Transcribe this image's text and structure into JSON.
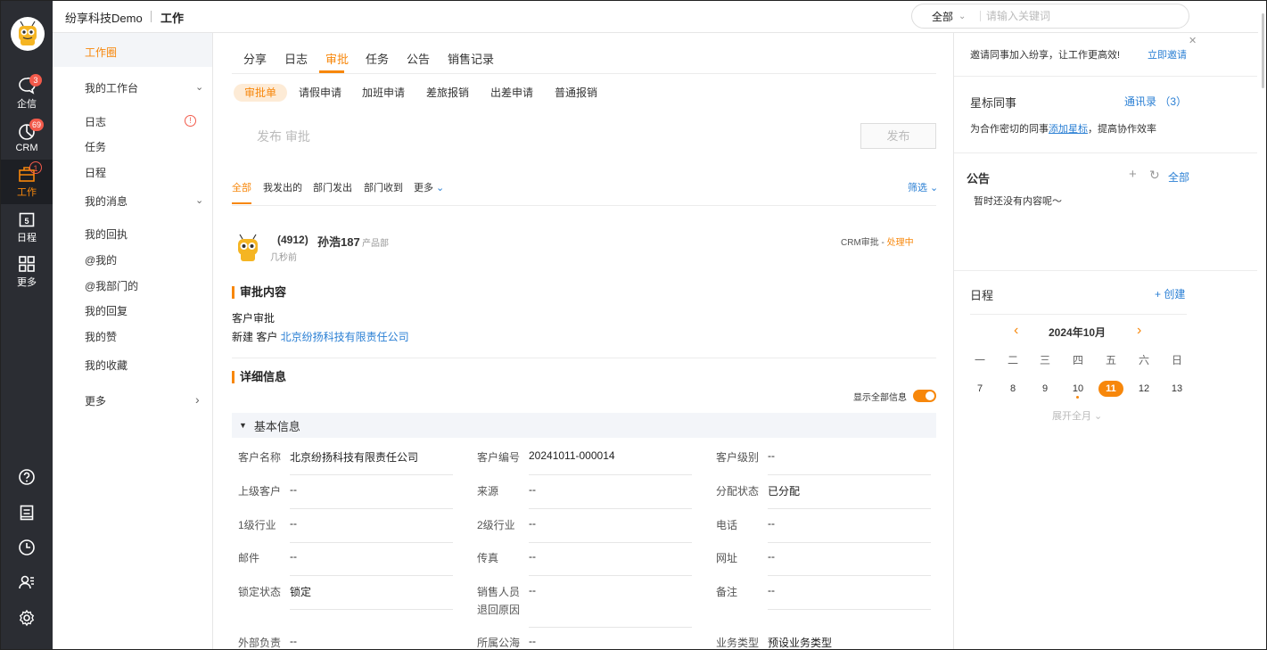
{
  "header": {
    "company": "纷享科技Demo",
    "section": "工作",
    "search_scope": "全部",
    "search_placeholder": "请输入关键词"
  },
  "rail": [
    {
      "label": "企信",
      "icon": "chat-icon",
      "badge": "3"
    },
    {
      "label": "CRM",
      "icon": "crm-icon",
      "badge": "69"
    },
    {
      "label": "工作",
      "icon": "briefcase-icon",
      "badge": "1",
      "active": true
    },
    {
      "label": "日程",
      "icon": "calendar-icon"
    },
    {
      "label": "更多",
      "icon": "grid-icon"
    }
  ],
  "rail_bottom_icons": [
    "help-icon",
    "notebook-icon",
    "clock-icon",
    "contacts-icon",
    "settings-icon"
  ],
  "sidebar": {
    "work_circle": "工作圈",
    "my_workbench": "我的工作台",
    "log": "日志",
    "log_badge": "!",
    "task": "任务",
    "schedule": "日程",
    "my_messages": "我的消息",
    "receipt": "我的回执",
    "at_me": "@我的",
    "at_dept": "@我部门的",
    "my_reply": "我的回复",
    "my_likes": "我的赞",
    "my_favorites": "我的收藏",
    "more": "更多"
  },
  "tabs": [
    "分享",
    "日志",
    "审批",
    "任务",
    "公告",
    "销售记录"
  ],
  "subtabs": [
    "审批单",
    "请假申请",
    "加班申请",
    "差旅报销",
    "出差申请",
    "普通报销"
  ],
  "publish": {
    "placeholder": "发布 审批",
    "button": "发布"
  },
  "filters": [
    "全部",
    "我发出的",
    "部门发出",
    "部门收到",
    "更多"
  ],
  "screen_label": "筛选",
  "post": {
    "id": "(4912)",
    "name": "孙浩187",
    "dept": "产品部",
    "time": "几秒前",
    "status_prefix": "CRM审批 - ",
    "status": "处理中",
    "approval_section": "审批内容",
    "approval_name": "客户审批",
    "approval_action": "新建 客户 ",
    "approval_link": "北京纷扬科技有限责任公司",
    "detail_section": "详细信息",
    "show_all": "显示全部信息",
    "group": "基本信息"
  },
  "fields": [
    [
      {
        "label": "客户名称",
        "value": "北京纷扬科技有限责任公司"
      },
      {
        "label": "客户编号",
        "value": "20241011-000014"
      },
      {
        "label": "客户级别",
        "value": "--"
      }
    ],
    [
      {
        "label": "上级客户",
        "value": "--"
      },
      {
        "label": "来源",
        "value": "--"
      },
      {
        "label": "分配状态",
        "value": "已分配"
      }
    ],
    [
      {
        "label": "1级行业",
        "value": "--"
      },
      {
        "label": "2级行业",
        "value": "--"
      },
      {
        "label": "电话",
        "value": "--"
      }
    ],
    [
      {
        "label": "邮件",
        "value": "--"
      },
      {
        "label": "传真",
        "value": "--"
      },
      {
        "label": "网址",
        "value": "--"
      }
    ],
    [
      {
        "label": "锁定状态",
        "value": "锁定"
      },
      {
        "label": "销售人员",
        "label2": "退回原因",
        "value": "--"
      },
      {
        "label": "备注",
        "value": "--"
      }
    ],
    [
      {
        "label": "外部负责",
        "value": "--"
      },
      {
        "label": "所属公海",
        "value": "--"
      },
      {
        "label": "业务类型",
        "value": "预设业务类型"
      }
    ]
  ],
  "right": {
    "invite_text": "邀请同事加入纷享，让工作更高效!",
    "invite_link": "立即邀请",
    "star_title": "星标同事",
    "contacts_link": "通讯录 （3）",
    "star_hint_pre": "为合作密切的同事",
    "star_hint_link": "添加星标",
    "star_hint_post": "，提高协作效率",
    "notice_title": "公告",
    "notice_all": "全部",
    "notice_empty": "暂时还没有内容呢～",
    "schedule_title": "日程",
    "schedule_create": "+ 创建",
    "month": "2024年10月",
    "weekdays": [
      "一",
      "二",
      "三",
      "四",
      "五",
      "六",
      "日"
    ],
    "days": [
      "7",
      "8",
      "9",
      "10",
      "11",
      "12",
      "13"
    ],
    "today": "11",
    "expand": "展开全月"
  },
  "colors": {
    "accent": "#f7870b",
    "link": "#2a7fd4",
    "rail": "#2b2d33",
    "badge": "#f25a4b"
  }
}
